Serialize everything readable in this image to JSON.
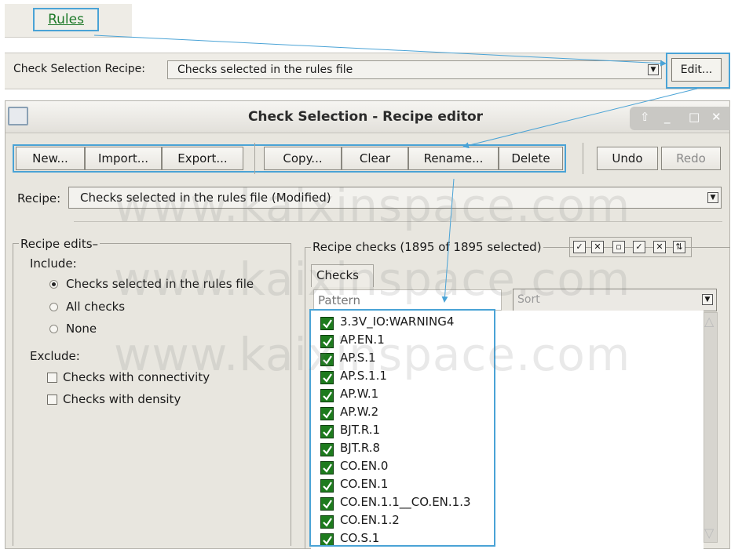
{
  "rules_tab": {
    "label": "Rules"
  },
  "recipe_strip": {
    "label": "Check Selection Recipe:",
    "selected": "Checks selected in the rules file",
    "edit_label": "Edit..."
  },
  "window": {
    "title": "Check Selection  - Recipe editor"
  },
  "toolbar": {
    "new": "New...",
    "import": "Import...",
    "export": "Export...",
    "copy": "Copy...",
    "clear": "Clear",
    "rename": "Rename...",
    "delete": "Delete",
    "undo": "Undo",
    "redo": "Redo"
  },
  "recipe": {
    "label": "Recipe:",
    "selected": "Checks selected in the rules file (Modified)"
  },
  "recipe_edits": {
    "title": "Recipe edits",
    "include_label": "Include:",
    "include_options": [
      "Checks selected in the rules file",
      "All checks",
      "None"
    ],
    "include_selected": 0,
    "exclude_label": "Exclude:",
    "exclude_options": [
      "Checks with connectivity",
      "Checks with density"
    ]
  },
  "recipe_checks": {
    "title": "Recipe checks (1895 of 1895 selected)",
    "tab": "Checks",
    "pattern_placeholder": "Pattern",
    "sort_label": "Sort",
    "items": [
      "3.3V_IO:WARNING4",
      "AP.EN.1",
      "AP.S.1",
      "AP.S.1.1",
      "AP.W.1",
      "AP.W.2",
      "BJT.R.1",
      "BJT.R.8",
      "CO.EN.0",
      "CO.EN.1",
      "CO.EN.1.1__CO.EN.1.3",
      "CO.EN.1.2",
      "CO.S.1"
    ]
  },
  "watermark": "www.kaixinspace.com",
  "colors": {
    "highlight": "#4aa3d6",
    "check_green": "#1e7b1e",
    "rules_text": "#1f7a2a"
  }
}
